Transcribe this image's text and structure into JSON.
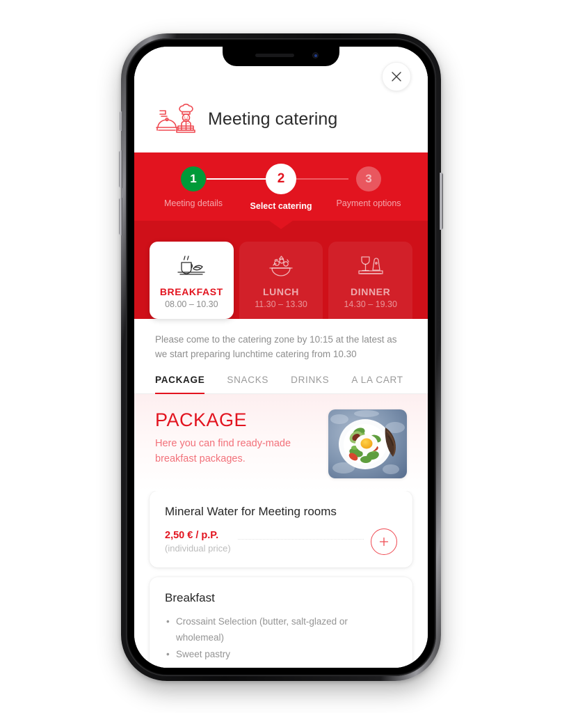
{
  "colors": {
    "brand_red": "#e2141f",
    "band_red": "#cf1019",
    "step_done_green": "#009a39",
    "muted_gray": "#9a9a9a"
  },
  "header": {
    "title": "Meeting catering",
    "chef_icon": "chef-catering-icon",
    "close_icon": "close-icon"
  },
  "stepper": {
    "steps": [
      {
        "number": "1",
        "label": "Meeting details",
        "state": "completed"
      },
      {
        "number": "2",
        "label": "Select catering",
        "state": "active"
      },
      {
        "number": "3",
        "label": "Payment options",
        "state": "upcoming"
      }
    ]
  },
  "meal_tabs": [
    {
      "name": "BREAKFAST",
      "time": "08.00 – 10.30",
      "icon": "coffee-croissant-icon",
      "active": true
    },
    {
      "name": "LUNCH",
      "time": "11.30 – 13.30",
      "icon": "salad-bowl-icon",
      "active": false
    },
    {
      "name": "DINNER",
      "time": "14.30 – 19.30",
      "icon": "wine-glass-plate-icon",
      "active": false
    }
  ],
  "info_note": "Please come to the catering zone by 10:15 at the latest as we start preparing lunchtime catering from 10.30",
  "category_tabs": [
    {
      "label": "PACKAGE",
      "active": true
    },
    {
      "label": "SNACKS",
      "active": false
    },
    {
      "label": "DRINKS",
      "active": false
    },
    {
      "label": "A LA CART",
      "active": false
    }
  ],
  "package_hero": {
    "heading": "PACKAGE",
    "subtitle": "Here you can find ready-made breakfast packages.",
    "photo_alt": "breakfast-plate-photo"
  },
  "products": [
    {
      "title": "Mineral Water for Meeting rooms",
      "price": "2,50 € / p.P.",
      "note": "(individual price)",
      "add_icon": "plus-icon",
      "items": []
    },
    {
      "title": "Breakfast",
      "price": "",
      "note": "",
      "add_icon": "plus-icon",
      "items": [
        "Crossaint Selection (butter, salt-glazed or wholemeal)",
        "Sweet pastry"
      ]
    }
  ]
}
